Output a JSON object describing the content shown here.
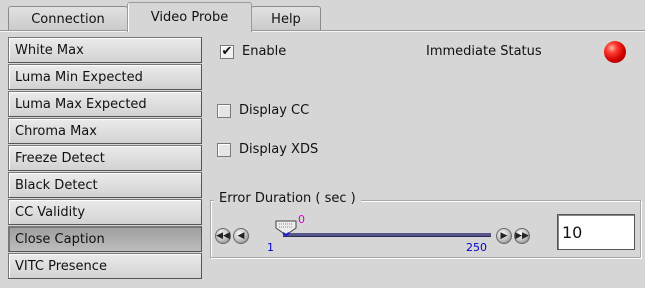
{
  "tabs": [
    {
      "label": "Connection"
    },
    {
      "label": "Video Probe"
    },
    {
      "label": "Help"
    }
  ],
  "active_tab": "Video Probe",
  "sidebar": {
    "items": [
      {
        "label": "White Max"
      },
      {
        "label": "Luma Min Expected"
      },
      {
        "label": "Luma Max Expected"
      },
      {
        "label": "Chroma Max"
      },
      {
        "label": "Freeze Detect"
      },
      {
        "label": "Black Detect"
      },
      {
        "label": "CC Validity"
      },
      {
        "label": "Close Caption",
        "selected": true
      },
      {
        "label": "VITC Presence"
      }
    ]
  },
  "main": {
    "enable": {
      "label": "Enable",
      "checked": true,
      "check_glyph": "✔"
    },
    "immediate_status": {
      "label": "Immediate Status",
      "color": "#e00000",
      "icon": "led-red-icon"
    },
    "display_cc": {
      "label": "Display CC",
      "checked": false
    },
    "display_xds": {
      "label": "Display XDS",
      "checked": false
    },
    "error_duration": {
      "legend": "Error Duration ( sec )",
      "min_label": "1",
      "max_label": "250",
      "thumb_value": "0",
      "value": "10",
      "nav_icons": {
        "first": "fast-rewind-icon",
        "prev": "step-back-icon",
        "next": "step-forward-icon",
        "last": "fast-forward-icon"
      }
    }
  },
  "colors": {
    "background": "#d6d6d6",
    "track": "#56568a",
    "tick_text": "#0000cc",
    "status_led": "#e00000"
  }
}
